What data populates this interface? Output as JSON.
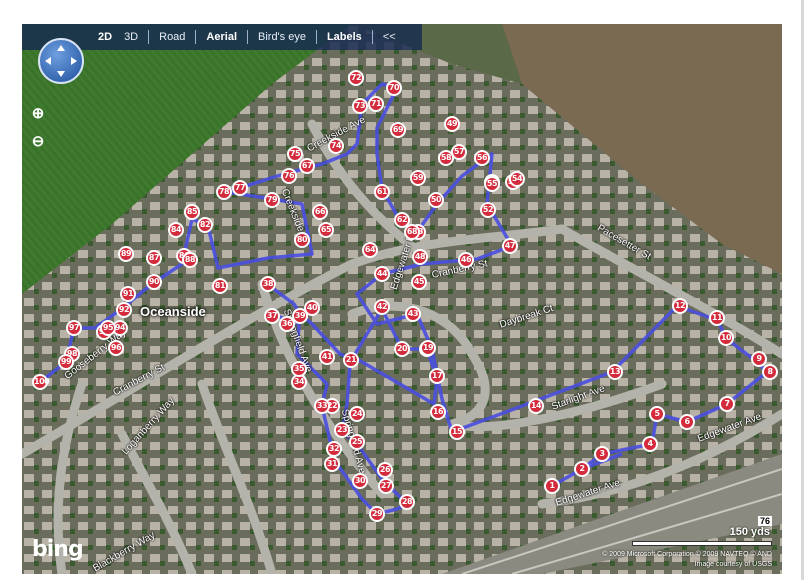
{
  "toolbar": {
    "items": [
      "2D",
      "3D",
      "Road",
      "Aerial",
      "Bird's eye",
      "Labels",
      "<<"
    ],
    "selected": [
      "2D",
      "Aerial",
      "Labels"
    ]
  },
  "zoom": {
    "in_icon": "zoom-in-icon",
    "out_icon": "zoom-out-icon"
  },
  "map": {
    "city_label": "Oceanside",
    "streets": [
      "Creekside Ave",
      "Creekside",
      "Edgewater Dr",
      "Cranberry St",
      "Pacesetter St",
      "Daybreak Ct",
      "Springfield Ave",
      "Starlight Ave",
      "Edgewater Ave",
      "Loganberry Way",
      "Cranberry St",
      "Gooseberry Way",
      "Blackberry Way",
      "Springfield Ave",
      "Edgewater Ave"
    ],
    "route_color": "#4a4ee0",
    "marker_color": "#d32b3c",
    "waypoints": [
      "1",
      "2",
      "3",
      "4",
      "5",
      "6",
      "7",
      "8",
      "9",
      "10",
      "11",
      "12",
      "13",
      "14",
      "15",
      "16",
      "17",
      "18",
      "19",
      "20",
      "21",
      "22",
      "23",
      "24",
      "25",
      "26",
      "27",
      "28",
      "29",
      "30",
      "31",
      "32",
      "33",
      "34",
      "35",
      "36",
      "37",
      "38",
      "39",
      "40",
      "41",
      "42",
      "43",
      "44",
      "45",
      "46",
      "47",
      "48",
      "49",
      "50",
      "51",
      "52",
      "53",
      "54",
      "55",
      "56",
      "57",
      "58",
      "59",
      "60",
      "61",
      "62",
      "63",
      "64",
      "65",
      "66",
      "67",
      "68",
      "69",
      "70",
      "71",
      "72",
      "73",
      "74",
      "75",
      "76",
      "77",
      "78",
      "79",
      "80",
      "81",
      "82",
      "83",
      "84",
      "85",
      "86",
      "87",
      "88",
      "89",
      "90",
      "91",
      "92",
      "93",
      "94",
      "95",
      "96",
      "97",
      "98",
      "99",
      "100"
    ]
  },
  "branding": {
    "logo": "bing"
  },
  "scale": {
    "value": "76",
    "label": "150 yds"
  },
  "copyright": {
    "line1": "© 2009 Microsoft Corporation   © 2009 NAVTEQ   © AND",
    "line2": "Image courtesy of USGS"
  }
}
